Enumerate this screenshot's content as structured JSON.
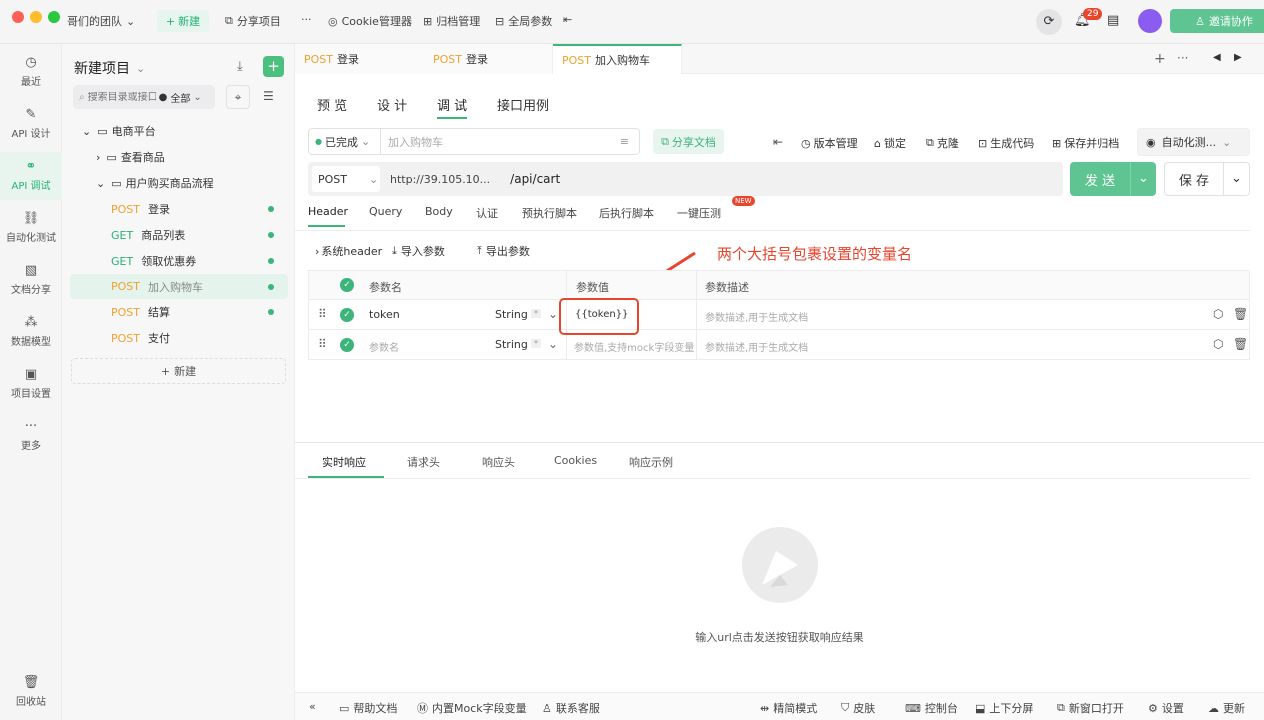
{
  "titlebar": {
    "team": "哥们的团队",
    "new_label": "新建",
    "share_project": "分享项目",
    "more": "···",
    "cookie_manager": "Cookie管理器",
    "archive": "归档管理",
    "global_params": "全局参数",
    "notif_count": "29",
    "invite": "邀请协作"
  },
  "leftnav": {
    "items": [
      "最近",
      "API 设计",
      "API 调试",
      "自动化测试",
      "文档分享",
      "数据模型",
      "项目设置",
      "更多"
    ],
    "trash": "回收站"
  },
  "tree": {
    "project": "新建项目",
    "search_placeholder": "搜索目录或接口",
    "filter": "全部",
    "root": "电商平台",
    "folder1": "查看商品",
    "folder2": "用户购买商品流程",
    "items": [
      {
        "method": "POST",
        "name": "登录"
      },
      {
        "method": "GET",
        "name": "商品列表"
      },
      {
        "method": "GET",
        "name": "领取优惠券"
      },
      {
        "method": "POST",
        "name": "加入购物车"
      },
      {
        "method": "POST",
        "name": "结算"
      },
      {
        "method": "POST",
        "name": "支付"
      }
    ],
    "new_btn": "新建"
  },
  "doc_tabs": [
    {
      "method": "POST",
      "name": "登录"
    },
    {
      "method": "POST",
      "name": "登录"
    },
    {
      "method": "POST",
      "name": "加入购物车"
    }
  ],
  "sub_tabs": [
    "预 览",
    "设 计",
    "调 试",
    "接口用例"
  ],
  "toolbar": {
    "status": "已完成",
    "name": "加入购物车",
    "share_doc": "分享文档",
    "version": "版本管理",
    "lock": "锁定",
    "clone": "克隆",
    "gen_code": "生成代码",
    "save_archive": "保存并归档",
    "env": "自动化测..."
  },
  "request": {
    "method": "POST",
    "base": "http://39.105.10...",
    "path": "/api/cart",
    "send": "发 送",
    "save": "保 存"
  },
  "param_tabs": [
    "Header",
    "Query",
    "Body",
    "认证",
    "预执行脚本",
    "后执行脚本",
    "一键压测"
  ],
  "new_badge": "NEW",
  "params_actions": {
    "sys_header": "系统header",
    "import": "导入参数",
    "export": "导出参数"
  },
  "annotation": "两个大括号包裹设置的变量名",
  "table": {
    "headers": [
      "参数名",
      "参数值",
      "参数描述"
    ],
    "rows": [
      {
        "name": "token",
        "type": "String",
        "value": "{{token}}",
        "desc": "参数描述,用于生成文档"
      },
      {
        "name": "参数名",
        "type": "String",
        "value": "参数值,支持mock字段变量",
        "desc": "参数描述,用于生成文档"
      }
    ]
  },
  "response_tabs": [
    "实时响应",
    "请求头",
    "响应头",
    "Cookies",
    "响应示例"
  ],
  "empty_text": "输入url点击发送按钮获取响应结果",
  "footer": {
    "help": "帮助文档",
    "mock": "内置Mock字段变量",
    "support": "联系客服",
    "compact": "精简模式",
    "skin": "皮肤",
    "console": "控制台",
    "split": "上下分屏",
    "new_window": "新窗口打开",
    "settings": "设置",
    "update": "更新"
  },
  "colors": {
    "accent": "#3cb47a",
    "post": "#f0a030",
    "annotation": "#e8452d"
  }
}
